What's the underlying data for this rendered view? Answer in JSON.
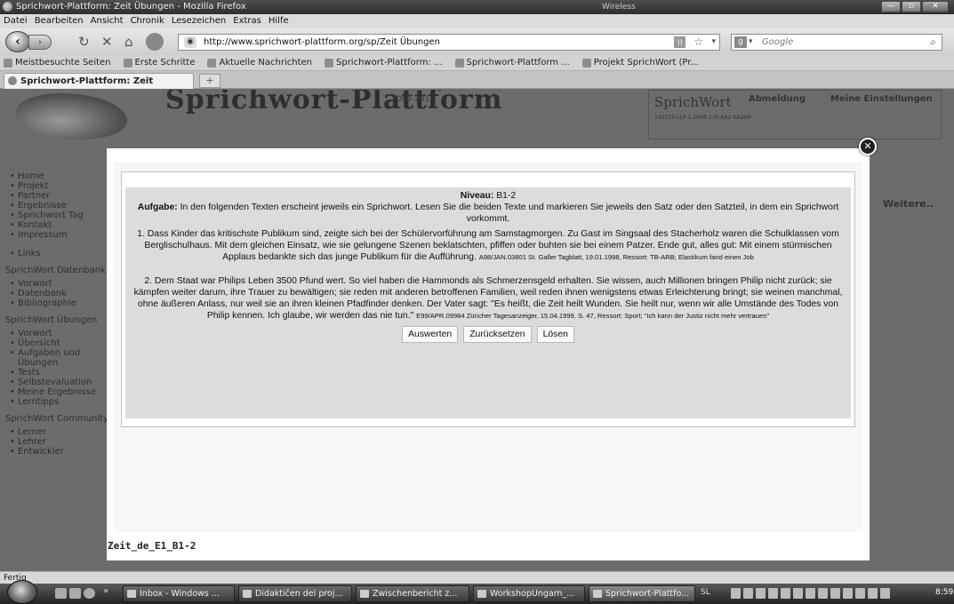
{
  "window": {
    "title": "Sprichwort-Plattform: Zeit Übungen - Mozilla Firefox",
    "wireless_label": "Wireless",
    "min_label": "—",
    "max_label": "▫",
    "close_label": "✕"
  },
  "menu": [
    "Datei",
    "Bearbeiten",
    "Ansicht",
    "Chronik",
    "Lesezeichen",
    "Extras",
    "Hilfe"
  ],
  "nav": {
    "back_icon": "back-arrow-icon",
    "url": "http://www.sprichwort-plattform.org/sp/Zeit Übungen",
    "search_placeholder": "Google"
  },
  "bookmarks": [
    "Meistbesuchte Seiten",
    "Erste Schritte",
    "Aktuelle Nachrichten",
    "Sprichwort-Plattform: ...",
    "Sprichwort-Plattform ...",
    "Projekt SprichWort (Pr..."
  ],
  "tab": {
    "label": "Sprichwort-Plattform: Zeit Übungen",
    "new_tab": "+"
  },
  "site": {
    "title": "Sprichwort-Plattform",
    "years": "2008-2010",
    "brand": "SprichWort",
    "project_code": "143376-LLP-1-2008-1-SI-KA2-KA2MP",
    "logout": "Abmeldung",
    "settings": "Meine Einstellungen",
    "weitere": "Weitere..",
    "sidebar": {
      "nav": [
        "Home",
        "Projekt",
        "Partner",
        "Ergebnisse",
        "Sprichwort Tag",
        "Kontakt",
        "Impressum"
      ],
      "links": [
        "Links"
      ],
      "db_header": "SprichWort Datenbank",
      "db": [
        "Vorwort",
        "Datenbank",
        "Bibliographie"
      ],
      "ex_header": "SprichWort Übungen",
      "ex": [
        "Vorwort",
        "Übersicht",
        "Aufgaben und Übungen",
        "Tests",
        "Selbstevaluation",
        "Meine Ergebnisse",
        "Lerntipps"
      ],
      "comm_header": "SprichWort Community",
      "comm": [
        "Lerner",
        "Lehrer",
        "Entwickler"
      ]
    }
  },
  "exercise": {
    "level_label": "Niveau:",
    "level": "B1-2",
    "task_label": "Aufgabe:",
    "task": "In den folgenden Texten erscheint jeweils ein Sprichwort. Lesen Sie die beiden Texte und markieren Sie jeweils den Satz oder den Satzteil, in dem ein Sprichwort vorkommt.",
    "text1": "1. Dass Kinder das kritischste Publikum sind, zeigte sich bei der Schülervorführung am Samstagmorgen. Zu Gast im Singsaal des Stacherholz waren die Schulklassen vom Berglischulhaus. Mit dem gleichen Einsatz, wie sie gelungene Szenen beklatschten, pfiffen oder buhten sie bei einem Patzer. Ende gut, alles gut: Mit einem stürmischen Applaus bedankte sich das junge Publikum für die Aufführung.",
    "source1": "A98/JAN.03801 St. Galler Tagblatt, 19.01.1998, Ressort: TB-ARB; Elastikum fand einen Job",
    "text2": "2. Dem Staat war Philips Leben 3500 Pfund wert. So viel haben die Hammonds als Schmerzensgeld erhalten. Sie wissen, auch Millionen bringen Philip nicht zurück; sie kämpfen weiter darum, ihre Trauer zu bewältigen; sie reden mit anderen betroffenen Familien, weil reden ihnen wenigstens etwas Erleichterung bringt; sie weinen manchmal, ohne äußeren Anlass, nur weil sie an ihren kleinen Pfadfinder denken. Der Vater sagt: \"Es heißt, die Zeit heilt Wunden. Sie heilt nur, wenn wir alle Umstände des Todes von Philip kennen. Ich glaube, wir werden das nie tun.\"",
    "source2": "E99/APR.09984 Züricher Tagesanzeiger, 15.04.1999, S. 47, Ressort: Sport; \"Ich kann der Justiz nicht mehr vertrauen\"",
    "buttons": {
      "evaluate": "Auswerten",
      "reset": "Zurücksetzen",
      "solve": "Lösen"
    },
    "caption": "Zeit_de_E1_B1-2"
  },
  "status": "Fertig",
  "taskbar": {
    "items": [
      "Inbox - Windows ...",
      "Didaktičen del proj...",
      "Zwischenbericht z...",
      "WorkshopUngarn_...",
      "Sprichwort-Plattfo..."
    ],
    "lang": "SL",
    "clock": "8:59"
  }
}
